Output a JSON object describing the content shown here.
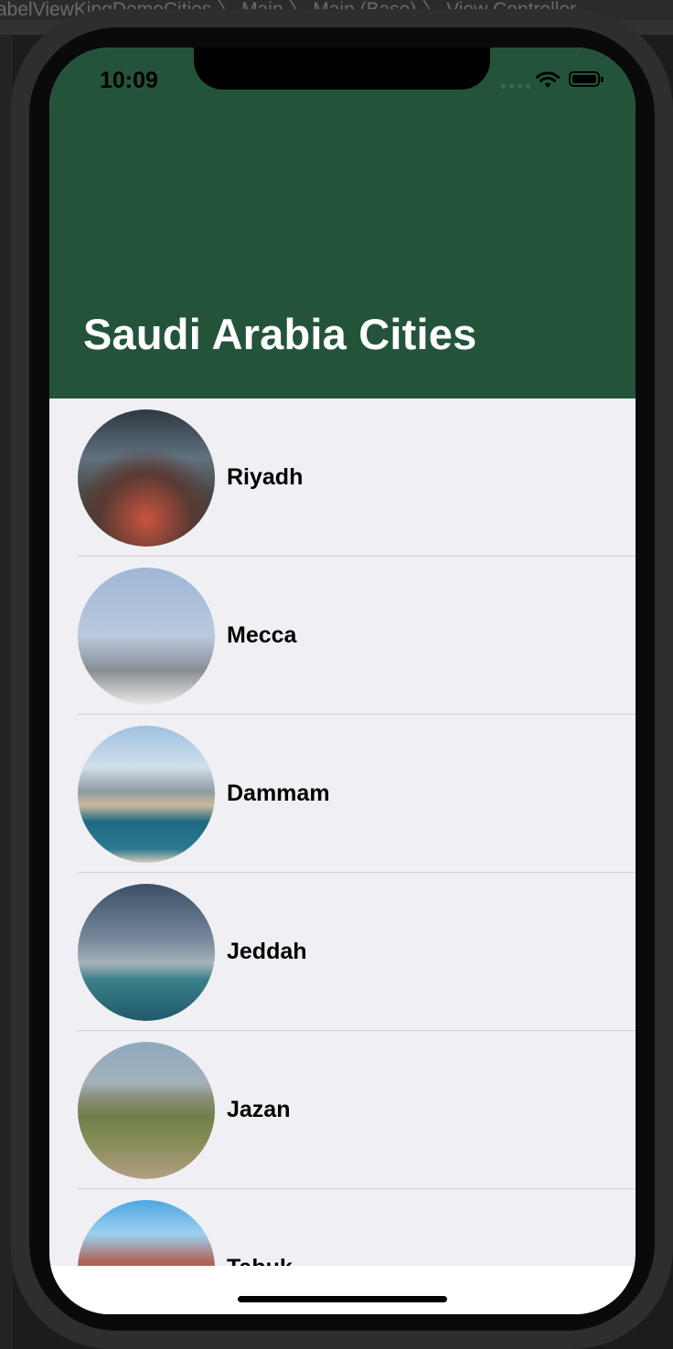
{
  "xcode": {
    "breadcrumb": "abelViewKingDemoCities  〉  Main  〉  Main (Base)  〉  View Controller"
  },
  "status_bar": {
    "time": "10:09"
  },
  "nav": {
    "title": "Saudi Arabia Cities",
    "background_color": "#23543a"
  },
  "cities": [
    {
      "name": "Riyadh"
    },
    {
      "name": "Mecca"
    },
    {
      "name": "Dammam"
    },
    {
      "name": "Jeddah"
    },
    {
      "name": "Jazan"
    },
    {
      "name": "Tabuk"
    }
  ]
}
